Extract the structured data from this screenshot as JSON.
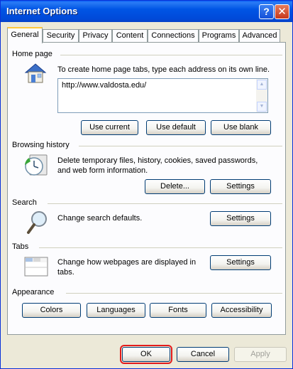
{
  "window": {
    "title": "Internet Options",
    "help_glyph": "?",
    "close_glyph": "✕"
  },
  "tabs": [
    {
      "label": "General",
      "active": true
    },
    {
      "label": "Security"
    },
    {
      "label": "Privacy"
    },
    {
      "label": "Content"
    },
    {
      "label": "Connections"
    },
    {
      "label": "Programs"
    },
    {
      "label": "Advanced"
    }
  ],
  "home_page": {
    "heading": "Home page",
    "description": "To create home page tabs, type each address on its own line.",
    "value": "http://www.valdosta.edu/",
    "use_current_label": "Use current",
    "use_default_label": "Use default",
    "use_blank_label": "Use blank"
  },
  "browsing_history": {
    "heading": "Browsing history",
    "description": "Delete temporary files, history, cookies, saved passwords, and web form information.",
    "delete_label": "Delete...",
    "settings_label": "Settings"
  },
  "search": {
    "heading": "Search",
    "description": "Change search defaults.",
    "settings_label": "Settings"
  },
  "tabs_section": {
    "heading": "Tabs",
    "description": "Change how webpages are displayed in tabs.",
    "settings_label": "Settings"
  },
  "appearance": {
    "heading": "Appearance",
    "colors_label": "Colors",
    "languages_label": "Languages",
    "fonts_label": "Fonts",
    "accessibility_label": "Accessibility"
  },
  "footer": {
    "ok_label": "OK",
    "cancel_label": "Cancel",
    "apply_label": "Apply"
  },
  "colors": {
    "titlebar": "#0055e5",
    "focus_highlight": "#e31c1c",
    "tab_accent": "#ffc83c"
  }
}
